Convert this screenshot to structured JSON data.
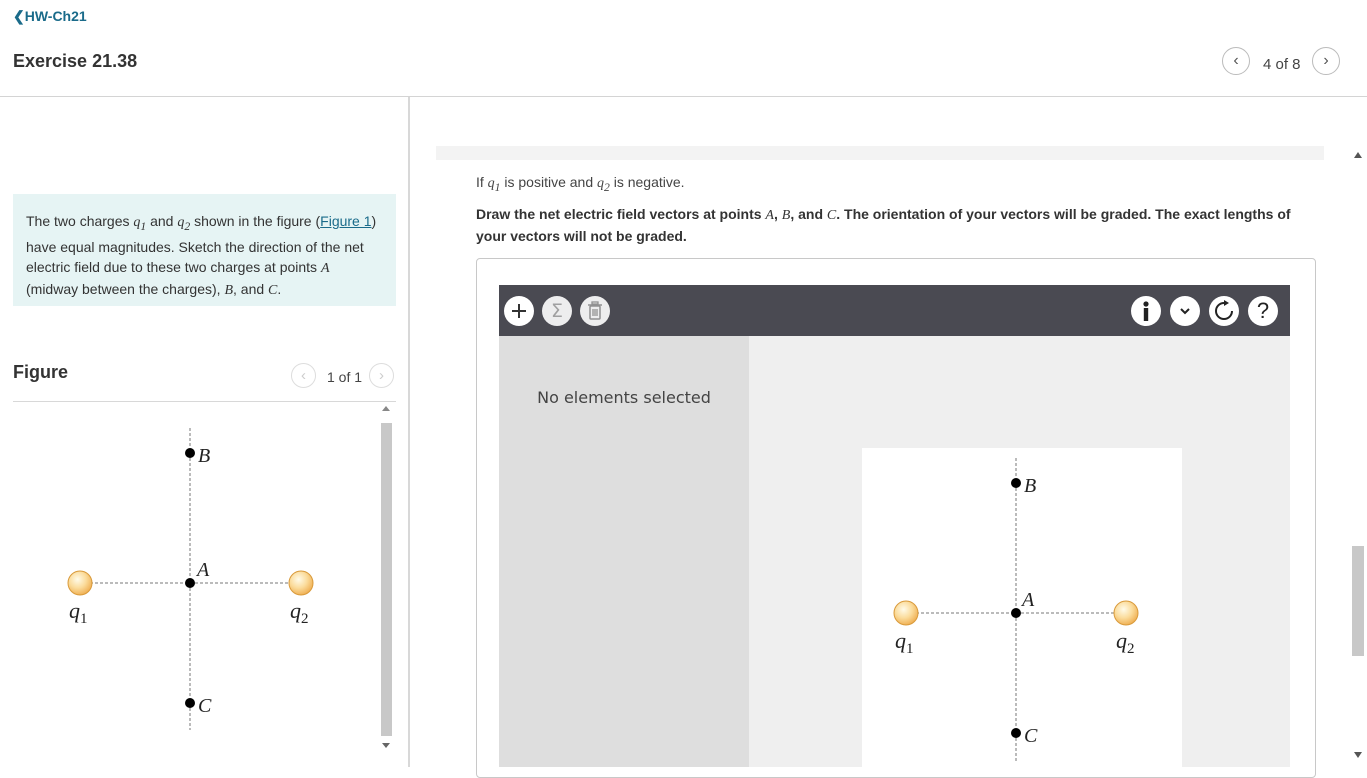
{
  "header": {
    "back_link": "HW-Ch21",
    "exercise_title": "Exercise 21.38",
    "pager": "4 of 8"
  },
  "problem": {
    "t1": "The two charges ",
    "q1": "q",
    "q1_sub": "1",
    "t2": " and ",
    "q2": "q",
    "q2_sub": "2",
    "t3": " shown in the figure (",
    "figure_link": "Figure 1",
    "t4": ") have equal magnitudes. Sketch the direction of the net electric field due to these two charges at points ",
    "pA": "A",
    "t5": " (midway between the charges), ",
    "pB": "B",
    "t6": ", and ",
    "pC": "C",
    "t7": "."
  },
  "figure_panel": {
    "title": "Figure",
    "pager": "1 of 1"
  },
  "figure_labels": {
    "B": "B",
    "A": "A",
    "C": "C",
    "q": "q",
    "sub1": "1",
    "sub2": "2"
  },
  "part": {
    "c1": "If ",
    "q1": "q",
    "q1_sub": "1",
    "c2": " is positive and ",
    "q2": "q",
    "q2_sub": "2",
    "c3": " is negative.",
    "i1": "Draw the net electric field vectors at points ",
    "pA": "A",
    "i2": ", ",
    "pB": "B",
    "i3": ", and ",
    "pC": "C",
    "i4": ". The orientation of your vectors will be graded. The exact lengths of your vectors will not be graded."
  },
  "drawing_tool": {
    "status": "No elements selected",
    "icons": [
      "plus-icon",
      "sigma-icon",
      "trash-icon",
      "info-icon",
      "chevron-down-icon",
      "reset-icon",
      "help-icon"
    ]
  },
  "colors": {
    "link": "#1a6b8a",
    "problem_bg": "#e6f4f4",
    "toolbar": "#4a4a52",
    "side_panel": "#dedede",
    "canvas_bg": "#efefef",
    "charge_fill": "#f7c97d"
  }
}
